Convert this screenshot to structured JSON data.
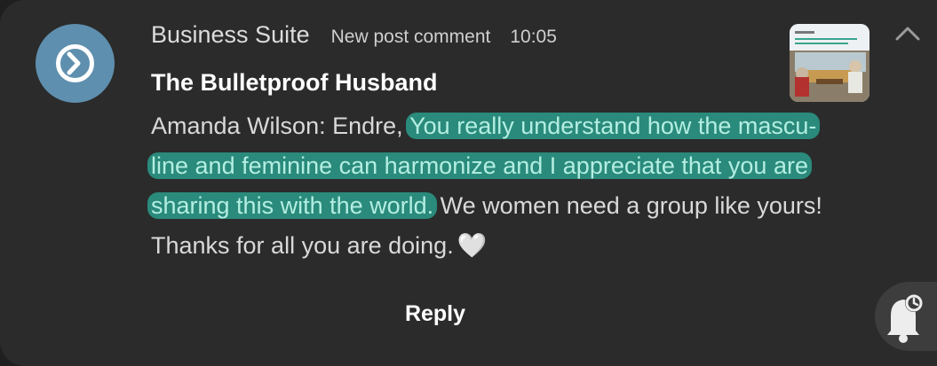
{
  "notification": {
    "app_icon": "business-suite-arrow-icon",
    "app_name": "Business Suite",
    "post_type": "New post comment",
    "time": "10:05",
    "title": "The Bulletproof Husband",
    "body": {
      "line1_pre": "Amanda Wilson: Endre, ",
      "line1_hl": "You really understand how the mascu-",
      "line2_hl": "line and feminine can harmonize and I appreciate that you are",
      "line3_hl": "sharing this with the world.",
      "line3_post": " We women need a group like yours!",
      "line4": "Thanks for all you are doing.",
      "line4_emoji": "🤍"
    },
    "highlight_color": "#2a8a7b",
    "thumbnail_icon": "post-thumbnail-image",
    "collapse_icon": "chevron-up-icon",
    "reply_label": "Reply",
    "snooze_icon": "bell-snooze-icon"
  }
}
